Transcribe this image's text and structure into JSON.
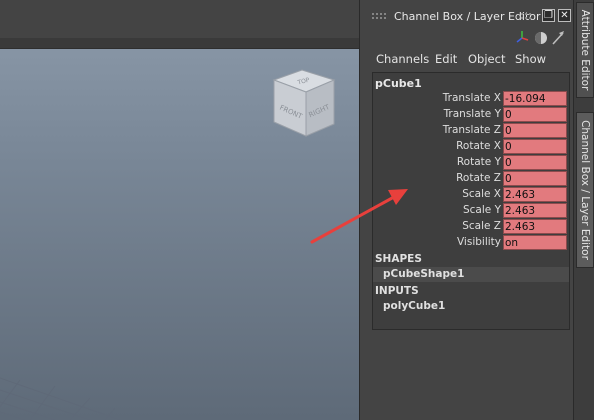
{
  "panel": {
    "title": "Channel Box / Layer Editor",
    "float_button": "❐",
    "close_button": "✕",
    "menu": [
      "Channels",
      "Edit",
      "Object",
      "Show"
    ]
  },
  "viewcube": {
    "top": "TOP",
    "front": "FRONT",
    "right": "RIGHT"
  },
  "channel_box": {
    "node": "pCube1",
    "attributes": [
      {
        "label": "Translate X",
        "value": "-16.094"
      },
      {
        "label": "Translate Y",
        "value": "0"
      },
      {
        "label": "Translate Z",
        "value": "0"
      },
      {
        "label": "Rotate X",
        "value": "0"
      },
      {
        "label": "Rotate Y",
        "value": "0"
      },
      {
        "label": "Rotate Z",
        "value": "0"
      },
      {
        "label": "Scale X",
        "value": "2.463"
      },
      {
        "label": "Scale Y",
        "value": "2.463"
      },
      {
        "label": "Scale Z",
        "value": "2.463"
      },
      {
        "label": "Visibility",
        "value": "on"
      }
    ],
    "shapes_header": "SHAPES",
    "shape": "pCubeShape1",
    "inputs_header": "INPUTS",
    "input": "polyCube1"
  },
  "side_tabs": {
    "attribute_editor": "Attribute Editor",
    "channel_box": "Channel Box / Layer Editor"
  },
  "colors": {
    "keyed_field": "#e27a7e",
    "annotation_arrow": "#e8403c",
    "panel_bg": "#444444"
  },
  "icons": [
    "axis-gizmo-icon",
    "display-mode-icon",
    "pick-arrow-icon"
  ]
}
